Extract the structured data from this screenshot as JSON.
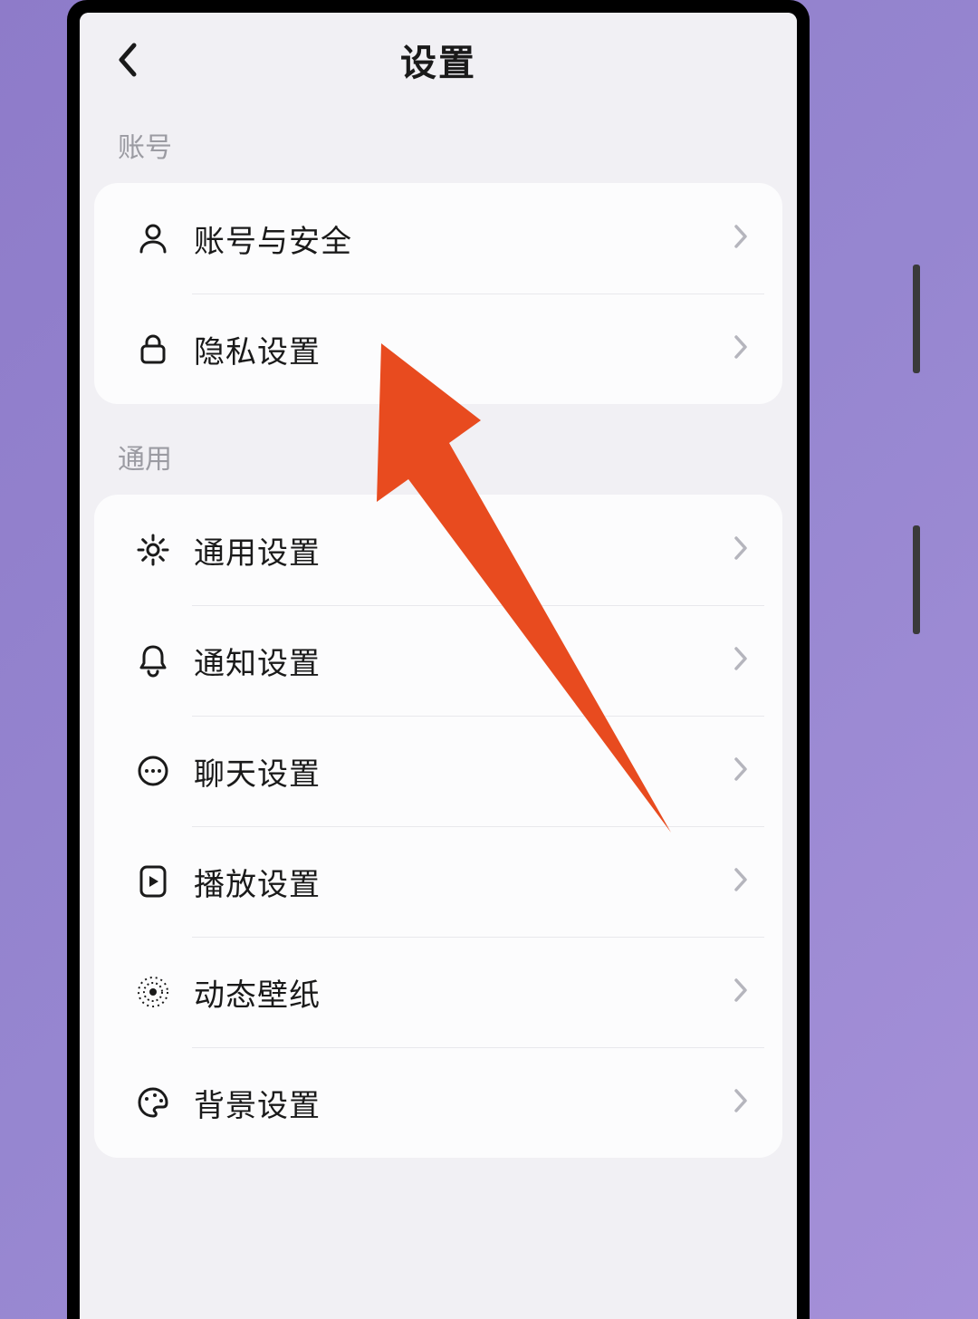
{
  "header": {
    "title": "设置"
  },
  "sections": [
    {
      "label": "账号",
      "items": [
        {
          "icon": "person-icon",
          "label": "账号与安全"
        },
        {
          "icon": "lock-icon",
          "label": "隐私设置"
        }
      ]
    },
    {
      "label": "通用",
      "items": [
        {
          "icon": "gear-icon",
          "label": "通用设置"
        },
        {
          "icon": "bell-icon",
          "label": "通知设置"
        },
        {
          "icon": "chat-icon",
          "label": "聊天设置"
        },
        {
          "icon": "play-icon",
          "label": "播放设置"
        },
        {
          "icon": "target-icon",
          "label": "动态壁纸"
        },
        {
          "icon": "palette-icon",
          "label": "背景设置"
        }
      ]
    }
  ],
  "colors": {
    "annotation": "#e84b1f",
    "card_bg": "#fcfcfd",
    "screen_bg": "#f1f0f4"
  }
}
